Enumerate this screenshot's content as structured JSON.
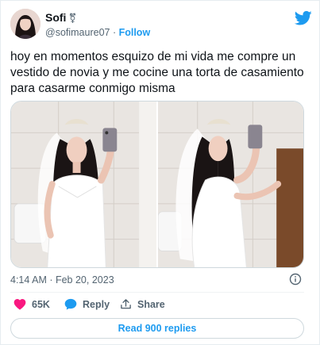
{
  "author": {
    "display_name": "Sofi",
    "name_badge": "⚧",
    "handle": "@sofimaure07",
    "separator": " · ",
    "follow_label": "Follow"
  },
  "tweet": {
    "text": "hoy en momentos esquizo de mi vida me compre un vestido de novia y me cocine una torta de casamiento para casarme conmigo misma",
    "timestamp": "4:14 AM · Feb 20, 2023"
  },
  "media": {
    "photos": [
      {
        "description_icon": "photo-mirror-selfie-front"
      },
      {
        "description_icon": "photo-mirror-selfie-side"
      }
    ]
  },
  "actions": {
    "like_count": "65K",
    "reply_label": "Reply",
    "share_label": "Share"
  },
  "footer": {
    "read_replies_label": "Read 900 replies"
  },
  "colors": {
    "brand": "#1d9bf0",
    "like": "#f91880",
    "text": "#0f1419",
    "muted": "#536471"
  }
}
